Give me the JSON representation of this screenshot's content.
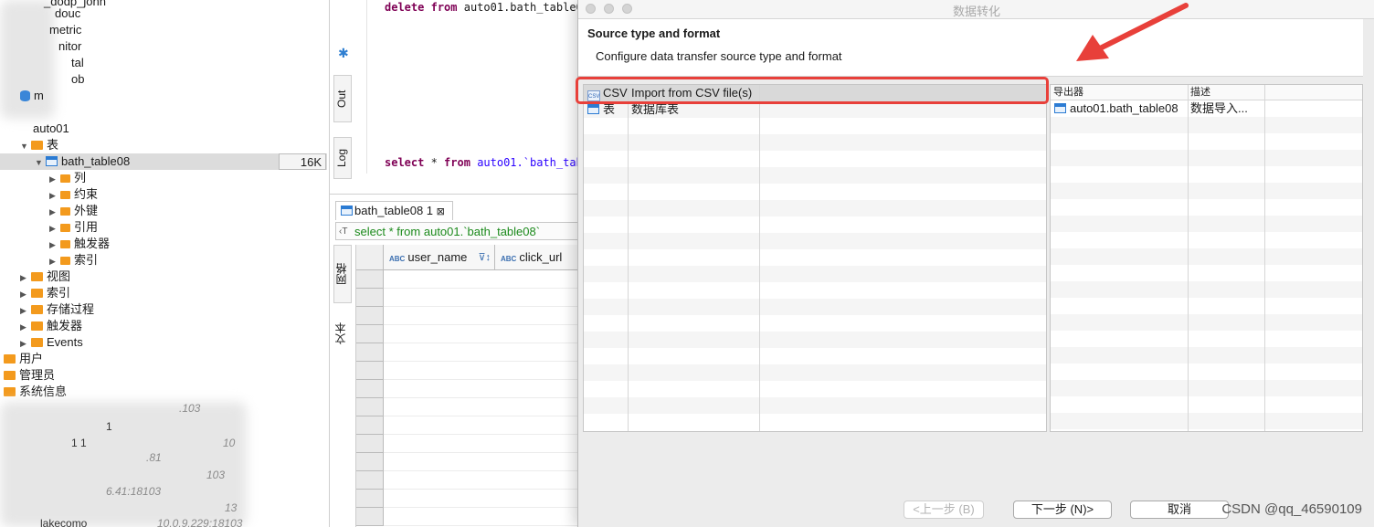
{
  "navigator": {
    "partial_rows": [
      "_dodp_john",
      "douc",
      "metric",
      "nitor",
      "tal",
      "ob",
      "m"
    ],
    "schema": "auto01",
    "tables_folder": "表",
    "selected_table": "bath_table08",
    "selected_table_size": "16K",
    "table_children": [
      "列",
      "约束",
      "外键",
      "引用",
      "触发器",
      "索引"
    ],
    "schema_children": [
      "视图",
      "索引",
      "存储过程",
      "触发器",
      "Events"
    ],
    "root_folders": [
      "用户",
      "管理员",
      "系统信息"
    ],
    "blurred_fragments": [
      ".103",
      "1",
      "1 1",
      ".81",
      "10",
      "103",
      "6.41:18103",
      "13",
      "lakecomo",
      "10.0.9.229:18103"
    ]
  },
  "editor": {
    "line1_kw1": "delete",
    "line1_kw2": "from",
    "line1_rest": "auto01.bath_table0",
    "line2_kw1": "select",
    "line2_rest": "* ",
    "line2_kw2": "from",
    "line2_rest2": "auto01.`bath_tab",
    "side_tab_out": "Out",
    "side_tab_log": "Log",
    "results_tab": "bath_table08 1",
    "query_text": "select * from auto01.`bath_table08`",
    "grid_tab_1": "网格",
    "grid_tab_2": "文本",
    "columns": [
      "user_name",
      "click_url"
    ]
  },
  "dialog": {
    "window_title": "数据转化",
    "page_title": "Source type and format",
    "page_subtitle": "Configure data transfer source type and format",
    "source_rows": [
      {
        "type": "CSV",
        "description": "Import from CSV file(s)",
        "selected": true
      },
      {
        "type": "表",
        "description": "数据库表",
        "selected": false
      }
    ],
    "target_headers": [
      "导出器",
      "描述"
    ],
    "target_rows": [
      {
        "exporter": "auto01.bath_table08",
        "description": "数据导入..."
      }
    ],
    "buttons": {
      "back": "<上一步 (B)",
      "next": "下一步 (N)>",
      "cancel": "取消"
    }
  },
  "watermark": "CSDN @qq_46590109",
  "colors": {
    "annotation_red": "#e8403a",
    "folder_orange": "#f39a1d",
    "keyword": "#7f0055",
    "query_green": "#1b8a1b"
  }
}
